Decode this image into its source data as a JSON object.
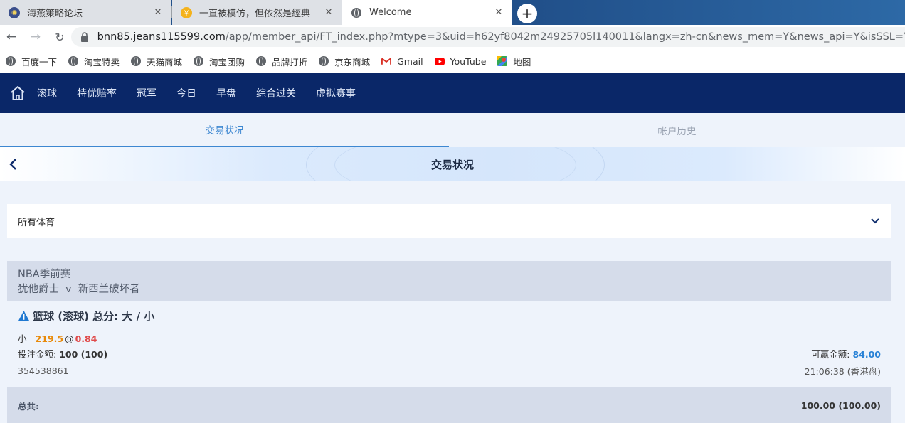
{
  "browser": {
    "tabs": [
      {
        "title": "海燕策略论坛",
        "icon": "forum-favicon-icon"
      },
      {
        "title": "一直被模仿，但依然是經典",
        "icon": "gold-coin-favicon-icon"
      },
      {
        "title": "Welcome",
        "icon": "globe-favicon-icon"
      }
    ],
    "new_tab_label": "+",
    "url_domain": "bnn85.jeans115599.com",
    "url_path": "/app/member_api/FT_index.php?mtype=3&uid=h62yf8042m24925705l140011&langx=zh-cn&news_mem=Y&news_api=Y&isSSL=Y&new_site=Y",
    "bookmarks": [
      {
        "label": "百度一下",
        "icon": "globe-icon"
      },
      {
        "label": "淘宝特卖",
        "icon": "globe-icon"
      },
      {
        "label": "天猫商城",
        "icon": "globe-icon"
      },
      {
        "label": "淘宝团购",
        "icon": "globe-icon"
      },
      {
        "label": "品牌打折",
        "icon": "globe-icon"
      },
      {
        "label": "京东商城",
        "icon": "globe-icon"
      },
      {
        "label": "Gmail",
        "icon": "gmail-icon"
      },
      {
        "label": "YouTube",
        "icon": "youtube-icon"
      },
      {
        "label": "地图",
        "icon": "maps-icon"
      }
    ]
  },
  "site_nav": {
    "items": [
      "滚球",
      "特优赔率",
      "冠军",
      "今日",
      "早盘",
      "综合过关",
      "虚拟赛事"
    ]
  },
  "sub_tabs": {
    "active": "交易状况",
    "inactive": "帐户历史"
  },
  "page": {
    "title": "交易状况"
  },
  "filter": {
    "selected": "所有体育"
  },
  "bet": {
    "league": "NBA季前赛",
    "home_team": "犹他爵士",
    "vs": "v",
    "away_team": "新西兰破坏者",
    "market": "篮球 (滚球) 总分: 大 / 小",
    "pick": "小",
    "line": "219.5",
    "at": "@",
    "odds": "0.84",
    "stake_label": "投注金额:",
    "stake_value": "100 (100)",
    "win_label": "可赢金额:",
    "win_value": "84.00",
    "ticket_id": "354538861",
    "time": "21:06:38 (香港盘)"
  },
  "totals": {
    "label": "总共:",
    "value": "100.00 (100.00)"
  },
  "colors": {
    "nav_bg": "#0a2768",
    "accent_blue": "#3d87d1",
    "line_orange": "#e88a0a",
    "odds_red": "#e04a4a",
    "win_blue": "#2781d6"
  }
}
